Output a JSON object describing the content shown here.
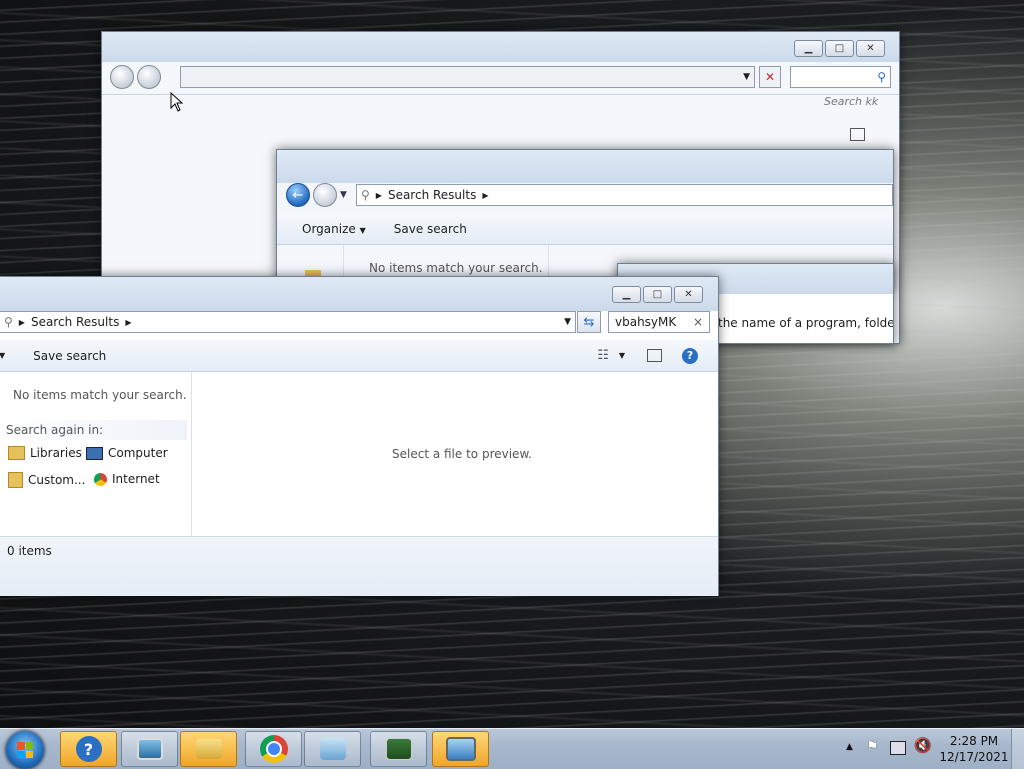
{
  "back_window": {
    "search_placeholder_partial": "Search kk"
  },
  "mid_window": {
    "breadcrumb": "Search Results",
    "organize_label": "Organize",
    "save_search_label": "Save search",
    "no_items_text": "No items match your search."
  },
  "dialog_snippet": {
    "text": "the name of a program, folder, do"
  },
  "front_window": {
    "breadcrumb": "Search Results",
    "search_value": "vbahsyMK",
    "save_search_label": "Save search",
    "no_items_text": "No items match your search.",
    "search_again_label": "Search again in:",
    "search_again_items": [
      "Libraries",
      "Computer",
      "Custom...",
      "Internet"
    ],
    "preview_text": "Select a file to preview.",
    "status_text": "0 items"
  },
  "taskbar": {
    "clock_time": "2:28 PM",
    "clock_date": "12/17/2021",
    "icons": [
      "start-orb",
      "help-icon",
      "picture-viewer-icon",
      "file-explorer-icon",
      "chrome-icon",
      "control-panel-icon",
      "device-manager-icon",
      "remote-desktop-icon"
    ]
  },
  "colors": {
    "taskbar": "#a8b8cc",
    "highlight": "#f0a629",
    "accent": "#2b6fc2"
  }
}
